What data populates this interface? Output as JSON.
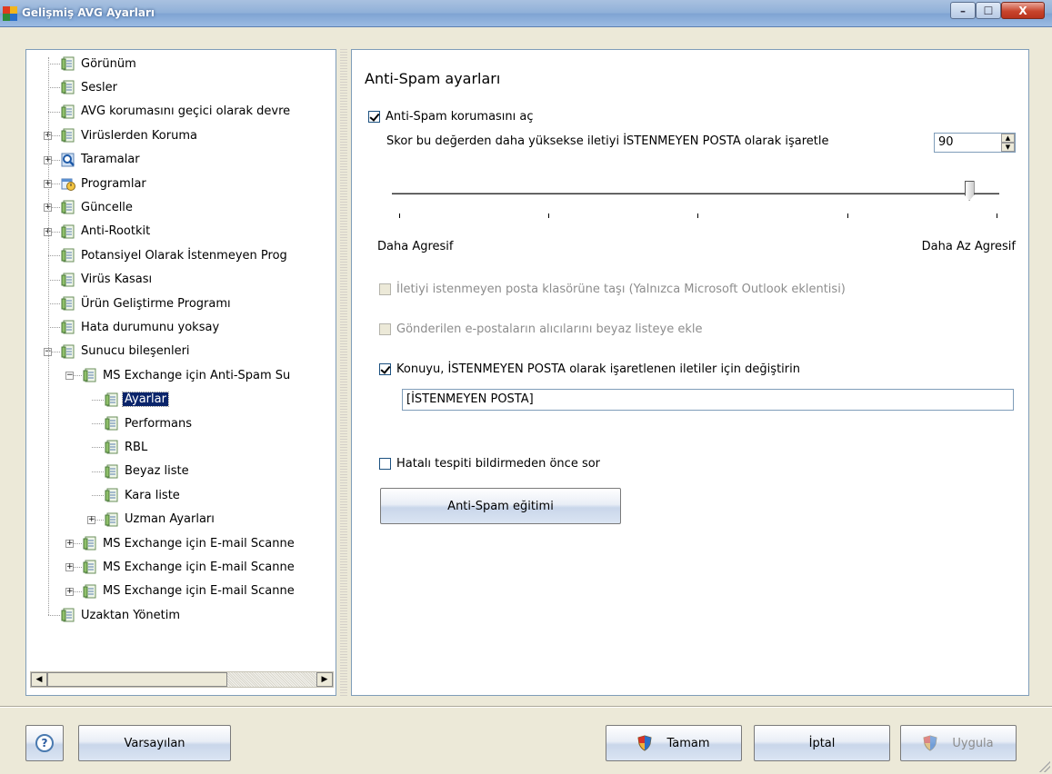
{
  "window": {
    "title": "Gelişmiş AVG Ayarları",
    "minimize": "–",
    "maximize": "☐",
    "close": "X"
  },
  "tree": [
    {
      "label": "Görünüm",
      "icon": "settings-page-icon",
      "level": 0,
      "expander": ""
    },
    {
      "label": "Sesler",
      "icon": "settings-page-icon",
      "level": 0,
      "expander": ""
    },
    {
      "label": "AVG korumasını geçici olarak devre",
      "icon": "settings-page-icon",
      "level": 0,
      "expander": ""
    },
    {
      "label": "Virüslerden Koruma",
      "icon": "settings-page-icon",
      "level": 0,
      "expander": "+"
    },
    {
      "label": "Taramalar",
      "icon": "magnifier-icon",
      "level": 0,
      "expander": "+"
    },
    {
      "label": "Programlar",
      "icon": "calendar-clock-icon",
      "level": 0,
      "expander": "+"
    },
    {
      "label": "Güncelle",
      "icon": "settings-page-icon",
      "level": 0,
      "expander": "+"
    },
    {
      "label": "Anti-Rootkit",
      "icon": "settings-page-icon",
      "level": 0,
      "expander": "+"
    },
    {
      "label": "Potansiyel Olarak İstenmeyen Prog",
      "icon": "settings-page-icon",
      "level": 0,
      "expander": ""
    },
    {
      "label": "Virüs Kasası",
      "icon": "settings-page-icon",
      "level": 0,
      "expander": ""
    },
    {
      "label": "Ürün Geliştirme Programı",
      "icon": "settings-page-icon",
      "level": 0,
      "expander": ""
    },
    {
      "label": "Hata durumunu yoksay",
      "icon": "settings-page-icon",
      "level": 0,
      "expander": ""
    },
    {
      "label": "Sunucu bileşenleri",
      "icon": "settings-page-icon",
      "level": 0,
      "expander": "−"
    },
    {
      "label": "MS Exchange için Anti-Spam Su",
      "icon": "settings-page-icon",
      "level": 1,
      "expander": "−"
    },
    {
      "label": "Ayarlar",
      "icon": "settings-page-icon",
      "level": 2,
      "expander": "",
      "selected": true
    },
    {
      "label": "Performans",
      "icon": "settings-page-icon",
      "level": 2,
      "expander": ""
    },
    {
      "label": "RBL",
      "icon": "settings-page-icon",
      "level": 2,
      "expander": ""
    },
    {
      "label": "Beyaz liste",
      "icon": "settings-page-icon",
      "level": 2,
      "expander": ""
    },
    {
      "label": "Kara liste",
      "icon": "settings-page-icon",
      "level": 2,
      "expander": ""
    },
    {
      "label": "Uzman Ayarları",
      "icon": "settings-page-icon",
      "level": 2,
      "expander": "+"
    },
    {
      "label": "MS Exchange için E-mail Scanne",
      "icon": "settings-page-icon",
      "level": 1,
      "expander": "+"
    },
    {
      "label": "MS Exchange için E-mail Scanne",
      "icon": "settings-page-icon",
      "level": 1,
      "expander": "+"
    },
    {
      "label": "MS Exchange için E-mail Scanne",
      "icon": "settings-page-icon",
      "level": 1,
      "expander": "+"
    },
    {
      "label": "Uzaktan Yönetim",
      "icon": "settings-page-icon",
      "level": 0,
      "expander": ""
    }
  ],
  "panel": {
    "title": "Anti-Spam ayarları",
    "enable_label": "Anti-Spam korumasını aç",
    "enable_checked": true,
    "score_label": "Skor bu değerden daha yüksekse iletiyi İSTENMEYEN POSTA olarak işaretle",
    "score_value": "90",
    "slider_level": 90,
    "slider_left": "Daha Agresif",
    "slider_right": "Daha Az Agresif",
    "move_label": "İletiyi istenmeyen posta klasörüne taşı (Yalnızca Microsoft Outlook eklentisi)",
    "whitelist_label": "Gönderilen e-postaların alıcılarını beyaz listeye ekle",
    "subject_label": "Konuyu, İSTENMEYEN POSTA olarak işaretlenen iletiler için değiştirin",
    "subject_value": "[İSTENMEYEN POSTA]",
    "ask_label": "Hatalı tespiti bildirmeden önce sor",
    "train_button": "Anti-Spam eğitimi"
  },
  "footer": {
    "help": "?",
    "default": "Varsayılan",
    "ok": "Tamam",
    "cancel": "İptal",
    "apply": "Uygula"
  },
  "colors": {
    "selection": "#0a246a",
    "border": "#7f9db9",
    "window_bg": "#ece9d8"
  }
}
